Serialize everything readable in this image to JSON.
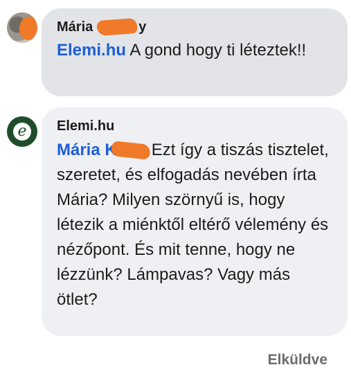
{
  "comments": [
    {
      "author_visible_start": "Mária",
      "author_visible_end": "y",
      "mention": "Elemi.hu",
      "text": " A gond hogy ti léteztek!!"
    },
    {
      "author": "Elemi.hu",
      "mention": "Mária K",
      "text": "Ezt így a tiszás tisztelet, szeretet, és elfogadás nevében írta Mária? Milyen szörnyű is, hogy létezik a miénktől eltérő vélemény és nézőpont. És mit tenne, hogy ne lézzünk? Lámpavas? Vagy más ötlet?"
    }
  ],
  "status": "Elküldve",
  "colors": {
    "mention": "#1d5ed8",
    "bubble_1": "#e3e4e8",
    "bubble_2": "#eff0f3",
    "redaction": "#f07a2a",
    "logo_bg": "#1f4d2a"
  },
  "icons": {
    "avatar_1": "user-photo-avatar",
    "avatar_2": "elemi-hu-logo-avatar"
  }
}
